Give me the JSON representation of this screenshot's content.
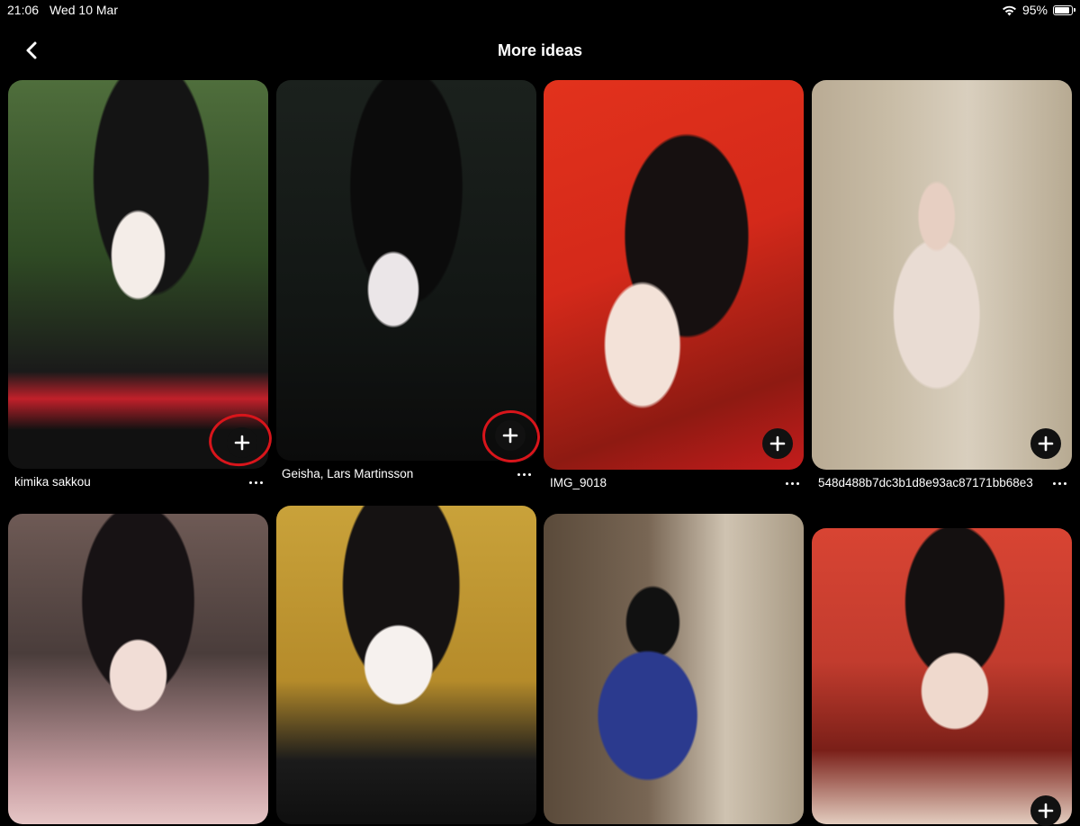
{
  "status_bar": {
    "time": "21:06",
    "date": "Wed 10 Mar",
    "battery": "95%",
    "battery_level": 0.95
  },
  "header": {
    "title": "More ideas",
    "back_icon": "chevron-left-icon"
  },
  "accent_color": "#d8151b",
  "pins": [
    {
      "caption": "kimika sakkou"
    },
    {
      "caption": "Geisha, Lars Martinsson"
    },
    {
      "caption": "IMG_9018"
    },
    {
      "caption": "548d488b7dc3b1d8e93ac87171bb68e3"
    },
    {
      "caption": ""
    },
    {
      "caption": ""
    },
    {
      "caption": ""
    },
    {
      "caption": ""
    }
  ],
  "save_icon": "plus-icon",
  "more_icon": "more-horizontal-icon"
}
